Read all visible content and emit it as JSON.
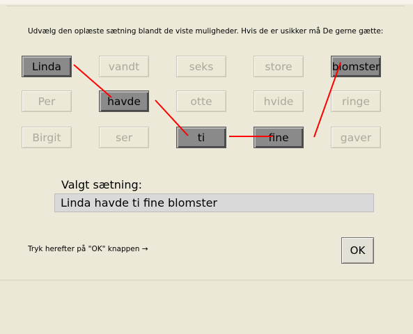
{
  "instruction": "Udvælg den oplæste sætning blandt de viste muligheder. Hvis de er usikker må De gerne gætte:",
  "words": [
    {
      "label": "Linda",
      "selected": true
    },
    {
      "label": "vandt",
      "selected": false
    },
    {
      "label": "seks",
      "selected": false
    },
    {
      "label": "store",
      "selected": false
    },
    {
      "label": "blomster",
      "selected": true
    },
    {
      "label": "Per",
      "selected": false
    },
    {
      "label": "havde",
      "selected": true
    },
    {
      "label": "otte",
      "selected": false
    },
    {
      "label": "hvide",
      "selected": false
    },
    {
      "label": "ringe",
      "selected": false
    },
    {
      "label": "Birgit",
      "selected": false
    },
    {
      "label": "ser",
      "selected": false
    },
    {
      "label": "ti",
      "selected": true
    },
    {
      "label": "fine",
      "selected": true
    },
    {
      "label": "gaver",
      "selected": false
    }
  ],
  "chosen_label": "Valgt sætning:",
  "chosen_sentence": "Linda havde ti fine blomster",
  "hint": "Tryk herefter på \"OK\" knappen →",
  "ok_label": "OK",
  "colors": {
    "connector_line": "#ff0000",
    "selected_button": "#8a8a8a",
    "background": "#ece9d8"
  }
}
